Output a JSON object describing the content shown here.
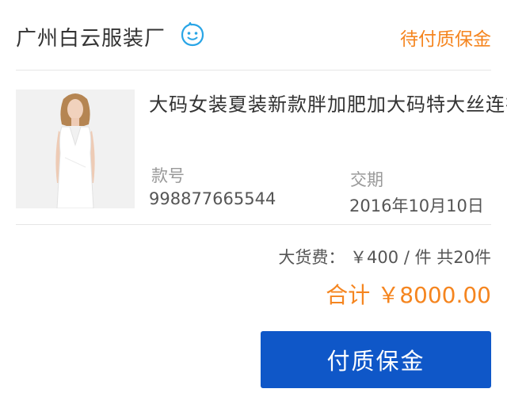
{
  "shop": {
    "name": "广州白云服装厂",
    "chat_icon": "smiley-chat-icon",
    "order_status": "待付质保金"
  },
  "product": {
    "title": "大码女装夏装新款胖加肥加大码特大丝连衣裙",
    "image": "white-sleeveless-dress-model",
    "style_label": "款号",
    "style_value": "998877665544",
    "delivery_label": "交期",
    "delivery_value": "2016年10月10日"
  },
  "pricing": {
    "bulk_label": "大货费：",
    "unit_price": "￥400",
    "unit": "/ 件",
    "quantity": "共20件",
    "total_label": "合计",
    "total_amount": "￥8000.00"
  },
  "actions": {
    "pay_deposit_label": "付质保金"
  },
  "colors": {
    "accent_orange": "#f5851f",
    "button_blue": "#0f57c8",
    "icon_blue": "#29a5e6"
  }
}
